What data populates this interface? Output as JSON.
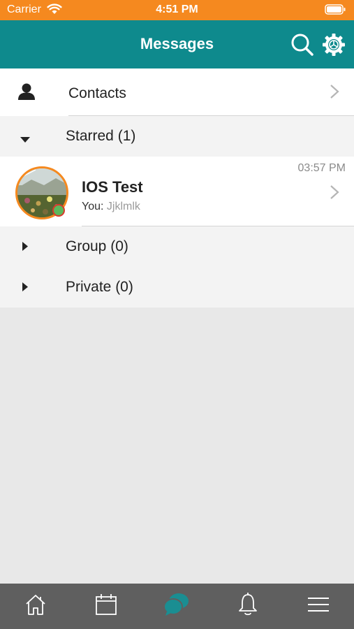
{
  "status_bar": {
    "carrier": "Carrier",
    "time": "4:51 PM"
  },
  "nav": {
    "title": "Messages"
  },
  "contacts": {
    "label": "Contacts"
  },
  "sections": {
    "starred": {
      "label": "Starred (1)"
    },
    "group": {
      "label": "Group (0)"
    },
    "private": {
      "label": "Private (0)"
    }
  },
  "chat": {
    "name": "IOS Test",
    "sender": "You:",
    "message": "Jjklmlk",
    "time": "03:57 PM"
  },
  "tabs": [
    {
      "icon": "home-icon"
    },
    {
      "icon": "calendar-icon"
    },
    {
      "icon": "messages-icon"
    },
    {
      "icon": "bell-icon"
    },
    {
      "icon": "menu-icon"
    }
  ],
  "colors": {
    "status_bar": "#f5891f",
    "nav_bar": "#0e8a8d",
    "tab_bar": "#5f5f5f",
    "active_tab": "#1a8e92",
    "online": "#5cb85c"
  }
}
